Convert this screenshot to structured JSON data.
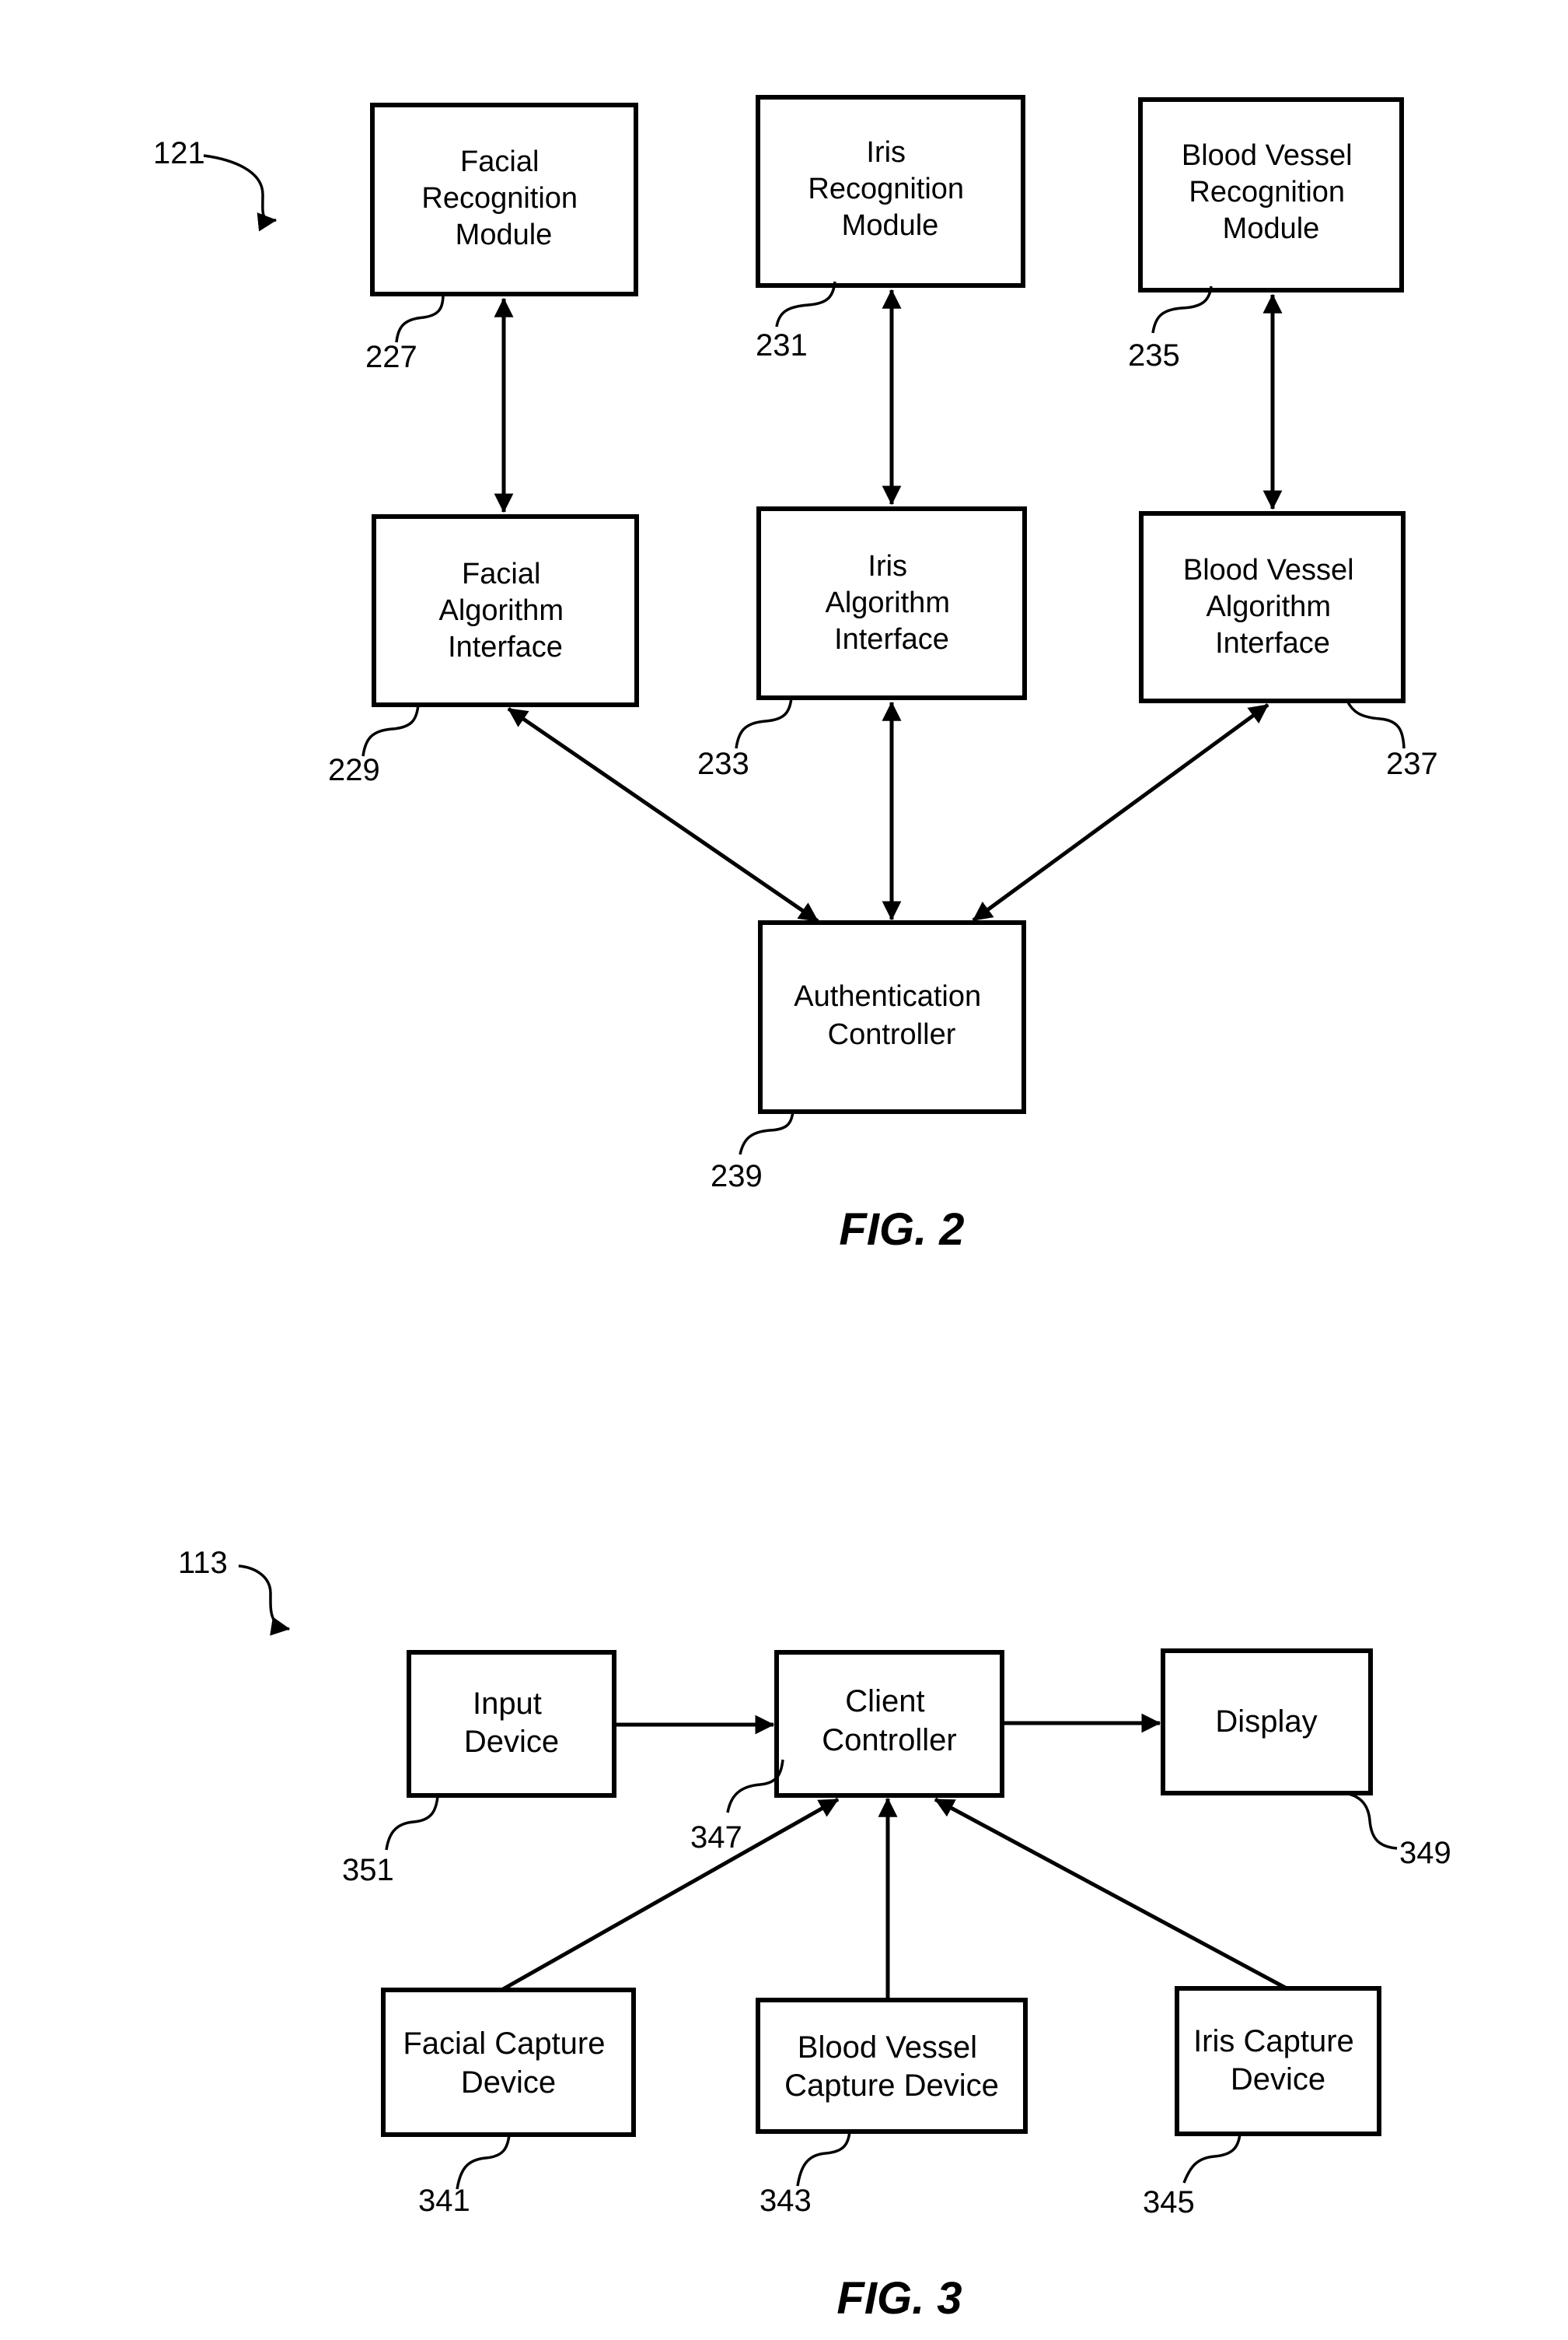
{
  "fig2": {
    "caption": "FIG. 2",
    "system_ref": "121",
    "boxes": {
      "facial_recognition_module": {
        "lines": [
          "Facial",
          "Recognition",
          "Module"
        ],
        "ref": "227"
      },
      "iris_recognition_module": {
        "lines": [
          "Iris",
          "Recognition",
          "Module"
        ],
        "ref": "231"
      },
      "blood_vessel_recognition_module": {
        "lines": [
          "Blood Vessel",
          "Recognition",
          "Module"
        ],
        "ref": "235"
      },
      "facial_algorithm_interface": {
        "lines": [
          "Facial",
          "Algorithm",
          "Interface"
        ],
        "ref": "229"
      },
      "iris_algorithm_interface": {
        "lines": [
          "Iris",
          "Algorithm",
          "Interface"
        ],
        "ref": "233"
      },
      "blood_vessel_algorithm_interface": {
        "lines": [
          "Blood Vessel",
          "Algorithm",
          "Interface"
        ],
        "ref": "237"
      },
      "authentication_controller": {
        "lines": [
          "Authentication",
          "Controller"
        ],
        "ref": "239"
      }
    },
    "connections": [
      {
        "from": "facial_recognition_module",
        "to": "facial_algorithm_interface",
        "direction": "bidirectional"
      },
      {
        "from": "iris_recognition_module",
        "to": "iris_algorithm_interface",
        "direction": "bidirectional"
      },
      {
        "from": "blood_vessel_recognition_module",
        "to": "blood_vessel_algorithm_interface",
        "direction": "bidirectional"
      },
      {
        "from": "facial_algorithm_interface",
        "to": "authentication_controller",
        "direction": "bidirectional"
      },
      {
        "from": "iris_algorithm_interface",
        "to": "authentication_controller",
        "direction": "bidirectional"
      },
      {
        "from": "blood_vessel_algorithm_interface",
        "to": "authentication_controller",
        "direction": "bidirectional"
      }
    ]
  },
  "fig3": {
    "caption": "FIG. 3",
    "system_ref": "113",
    "boxes": {
      "input_device": {
        "lines": [
          "Input",
          "Device"
        ],
        "ref": "351"
      },
      "client_controller": {
        "lines": [
          "Client",
          "Controller"
        ],
        "ref": "347"
      },
      "display": {
        "lines": [
          "Display"
        ],
        "ref": "349"
      },
      "facial_capture_device": {
        "lines": [
          "Facial Capture",
          "Device"
        ],
        "ref": "341"
      },
      "blood_vessel_capture_device": {
        "lines": [
          "Blood Vessel",
          "Capture Device"
        ],
        "ref": "343"
      },
      "iris_capture_device": {
        "lines": [
          "Iris Capture",
          "Device"
        ],
        "ref": "345"
      }
    },
    "connections": [
      {
        "from": "input_device",
        "to": "client_controller",
        "direction": "forward"
      },
      {
        "from": "client_controller",
        "to": "display",
        "direction": "forward"
      },
      {
        "from": "facial_capture_device",
        "to": "client_controller",
        "direction": "forward"
      },
      {
        "from": "blood_vessel_capture_device",
        "to": "client_controller",
        "direction": "forward"
      },
      {
        "from": "iris_capture_device",
        "to": "client_controller",
        "direction": "forward"
      }
    ]
  }
}
